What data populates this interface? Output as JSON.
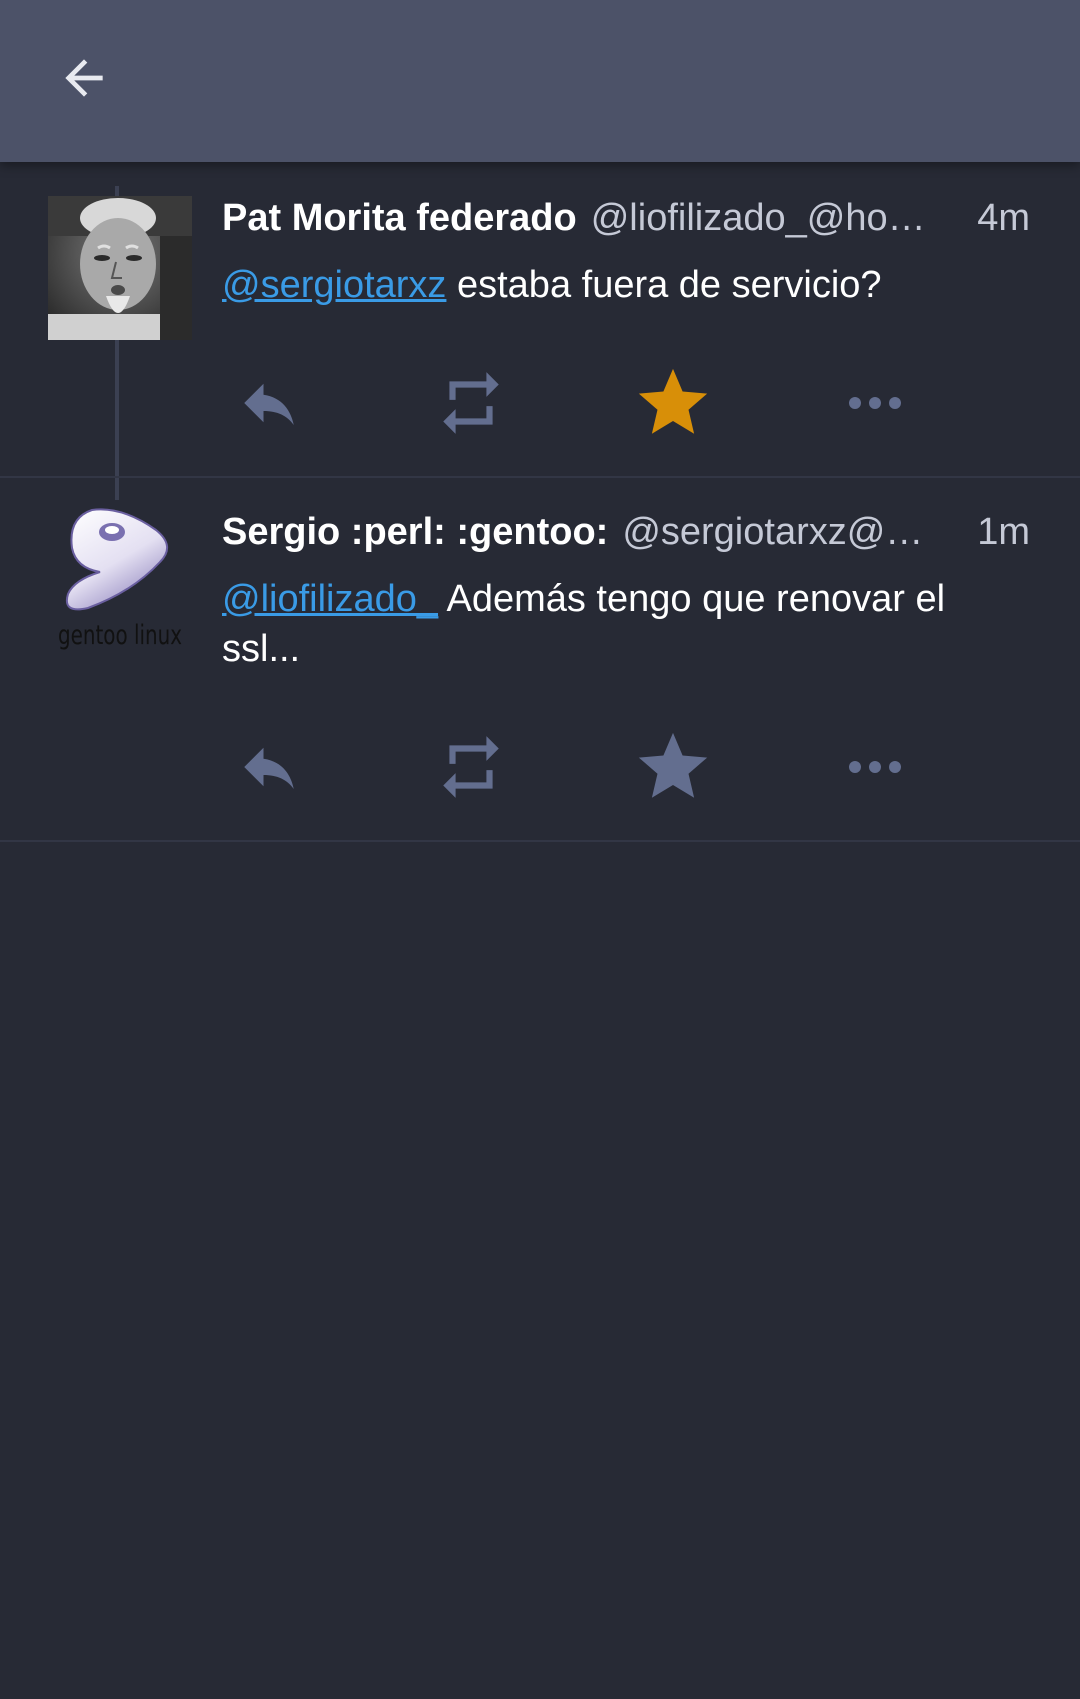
{
  "colors": {
    "toolbar": "#4c5268",
    "background": "#272a35",
    "accent_link": "#3a9be6",
    "favourited": "#d88f08",
    "action_icon": "#636e8f"
  },
  "toolbar": {
    "back_icon": "arrow-left-icon"
  },
  "statuses": [
    {
      "display_name": "Pat Morita federado",
      "account": "@liofilizado_@ho…",
      "time": "4m",
      "mention": "@sergiotarxz",
      "text": " estaba fuera de servicio?",
      "favourited": true,
      "icons": [
        "reply-icon",
        "boost-icon",
        "star-icon",
        "more-icon"
      ]
    },
    {
      "display_name": "Sergio :perl: :gentoo:",
      "account": "@sergiotarxz@…",
      "time": "1m",
      "mention": "@liofilizado_",
      "text": " Además tengo que renovar el ssl...",
      "avatar_text": "gentoo linux",
      "favourited": false,
      "icons": [
        "reply-icon",
        "boost-icon",
        "star-icon",
        "more-icon"
      ]
    }
  ]
}
